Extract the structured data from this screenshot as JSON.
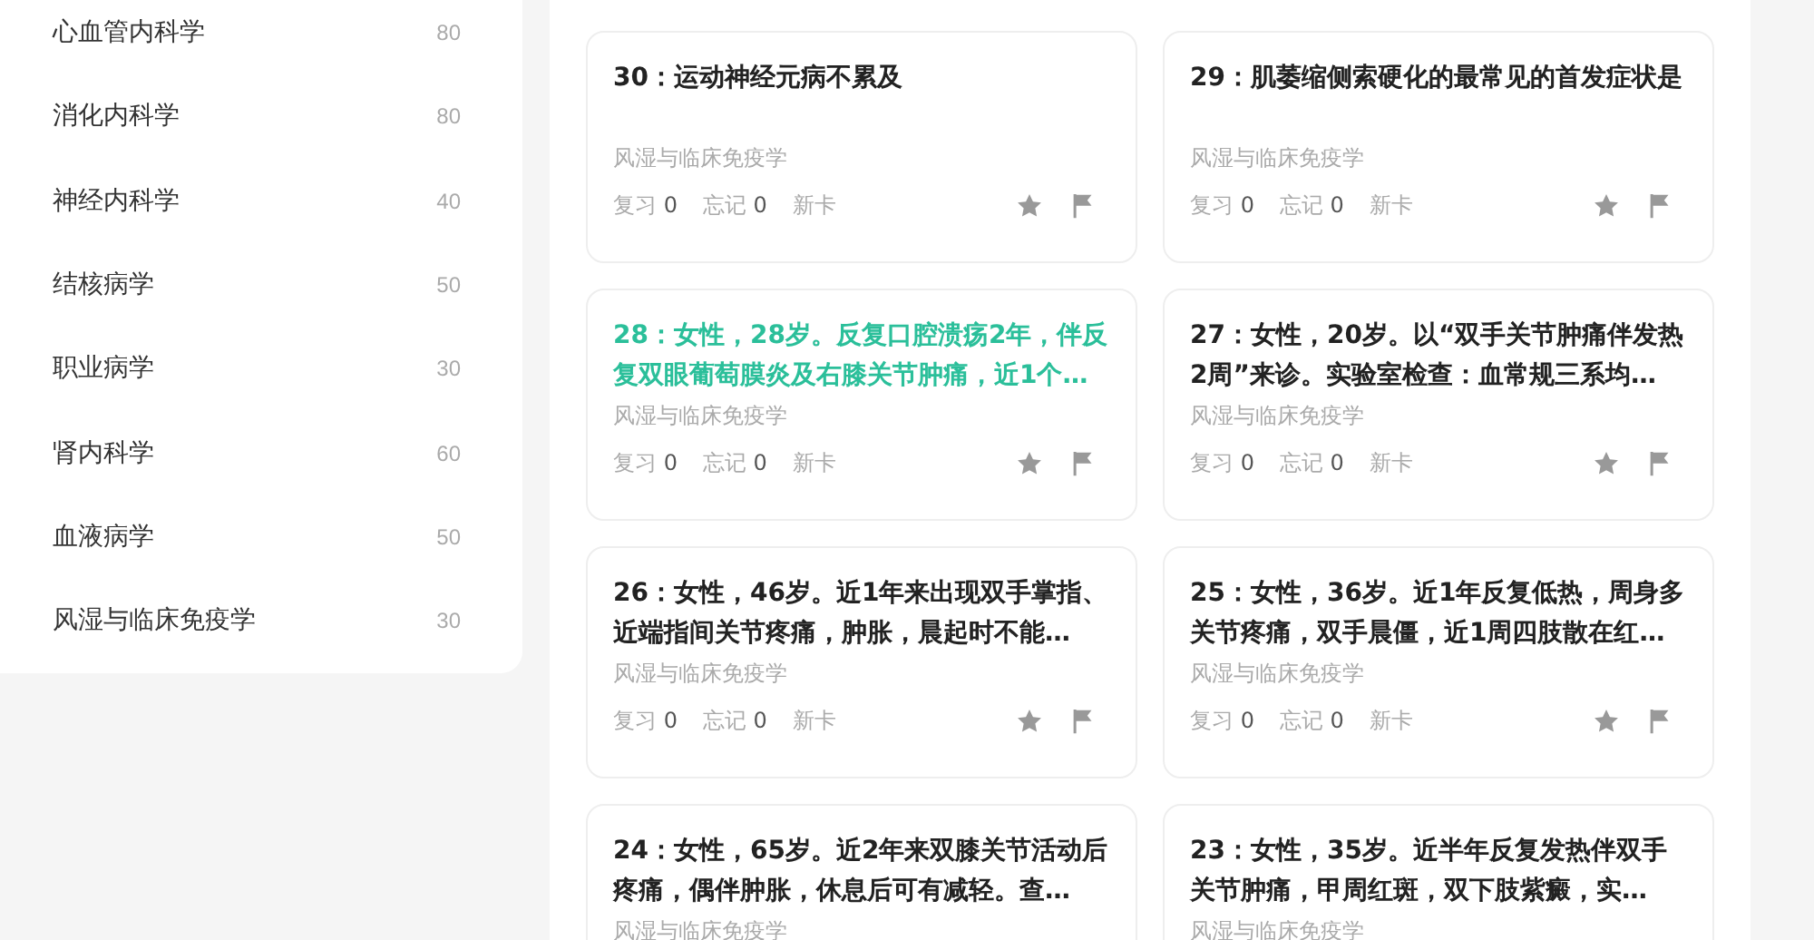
{
  "sidebar": {
    "items": [
      {
        "name": "心血管内科学",
        "count": "80"
      },
      {
        "name": "消化内科学",
        "count": "80"
      },
      {
        "name": "神经内科学",
        "count": "40"
      },
      {
        "name": "结核病学",
        "count": "50"
      },
      {
        "name": "职业病学",
        "count": "30"
      },
      {
        "name": "肾内科学",
        "count": "60"
      },
      {
        "name": "血液病学",
        "count": "50"
      },
      {
        "name": "风湿与临床免疫学",
        "count": "30"
      }
    ]
  },
  "cards": [
    {
      "title": "30：运动神经元病不累及",
      "selected": false,
      "category": "风湿与临床免疫学",
      "stats": [
        {
          "label": "复习",
          "count": "0"
        },
        {
          "label": "忘记",
          "count": "0"
        }
      ],
      "status": "新卡"
    },
    {
      "title": "29：肌萎缩侧索硬化的最常见的首发症状是",
      "selected": false,
      "category": "风湿与临床免疫学",
      "stats": [
        {
          "label": "复习",
          "count": "0"
        },
        {
          "label": "忘记",
          "count": "0"
        }
      ],
      "status": "新卡"
    },
    {
      "title": "28：女性，28岁。反复口腔溃疡2年，伴反复双眼葡萄膜炎及右膝关节肿痛，近1个…",
      "selected": true,
      "category": "风湿与临床免疫学",
      "stats": [
        {
          "label": "复习",
          "count": "0"
        },
        {
          "label": "忘记",
          "count": "0"
        }
      ],
      "status": "新卡"
    },
    {
      "title": "27：女性，20岁。以“双手关节肿痛伴发热2周”来诊。实验室检查：血常规三系均…",
      "selected": false,
      "category": "风湿与临床免疫学",
      "stats": [
        {
          "label": "复习",
          "count": "0"
        },
        {
          "label": "忘记",
          "count": "0"
        }
      ],
      "status": "新卡"
    },
    {
      "title": "26：女性，46岁。近1年来出现双手掌指、近端指间关节疼痛，肿胀，晨起时不能…",
      "selected": false,
      "category": "风湿与临床免疫学",
      "stats": [
        {
          "label": "复习",
          "count": "0"
        },
        {
          "label": "忘记",
          "count": "0"
        }
      ],
      "status": "新卡"
    },
    {
      "title": "25：女性，36岁。近1年反复低热，周身多关节疼痛，双手晨僵，近1周四肢散在红…",
      "selected": false,
      "category": "风湿与临床免疫学",
      "stats": [
        {
          "label": "复习",
          "count": "0"
        },
        {
          "label": "忘记",
          "count": "0"
        }
      ],
      "status": "新卡"
    },
    {
      "title": "24：女性，65岁。近2年来双膝关节活动后疼痛，偶伴肿胀，休息后可有减轻。查…",
      "selected": false,
      "category": "风湿与临床免疫学"
    },
    {
      "title": "23：女性，35岁。近半年反复发热伴双手关节肿痛，甲周红斑，双下肢紫癜，实…",
      "selected": false,
      "category": "风湿与临床免疫学"
    }
  ]
}
